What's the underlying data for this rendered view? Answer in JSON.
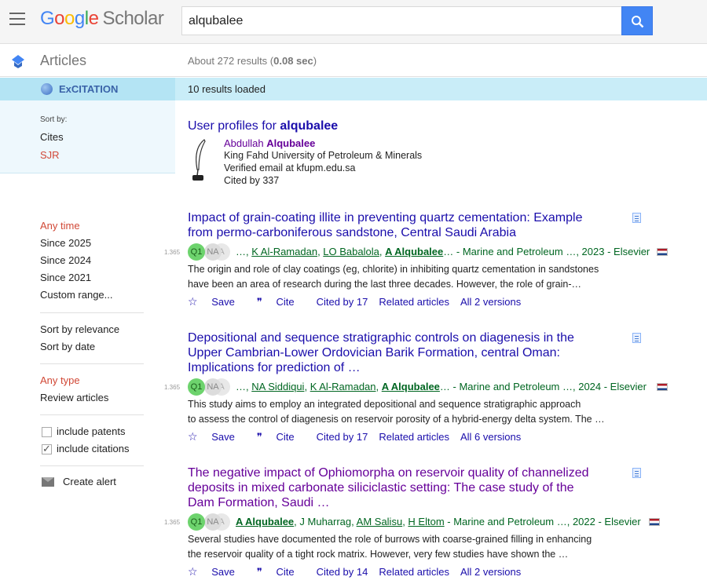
{
  "header": {
    "logo_letters": [
      "G",
      "o",
      "o",
      "g",
      "l",
      "e"
    ],
    "logo_suffix": "Scholar",
    "search_value": "alqubalee"
  },
  "subhead": {
    "section": "Articles",
    "results_prefix": "About 272 results (",
    "results_time": "0.08 sec",
    "results_suffix": ")"
  },
  "excitation": {
    "label": "ExCITATION",
    "status": "10 results loaded"
  },
  "sort_panel": {
    "label": "Sort by:",
    "cites": "Cites",
    "sjr": "SJR"
  },
  "time_filters": [
    "Any time",
    "Since 2025",
    "Since 2024",
    "Since 2021",
    "Custom range..."
  ],
  "sort_options": [
    "Sort by relevance",
    "Sort by date"
  ],
  "type_filters": [
    "Any type",
    "Review articles"
  ],
  "checks": {
    "patents": "include patents",
    "citations": "include citations"
  },
  "create_alert": "Create alert",
  "profiles": {
    "title_prefix": "User profiles for ",
    "title_query": "alqubalee",
    "name_first": "Abdullah ",
    "name_last": "Alqubalee",
    "affiliation": "King Fahd University of Petroleum & Minerals",
    "email": "Verified email at kfupm.edu.sa",
    "cited_by": "Cited by 337"
  },
  "results": [
    {
      "title_line1": "Impact of grain-coating illite in preventing quartz cementation: Example",
      "title_line2": "from permo-carboniferous sandstone, Central Saudi Arabia",
      "sjr": "1.365",
      "q1": "Q1",
      "na": "NA",
      "na2": "A",
      "authors_prefix": "…, ",
      "authors": [
        "K Al-Ramadan",
        "LO Babalola",
        "A Alqubalee"
      ],
      "authors_suffix": "… - Marine and Petroleum …, 2023 - Elsevier",
      "snippet_line1": "The origin and role of clay coatings (eg, chlorite) in inhibiting quartz cementation in sandstones",
      "snippet_line2": "have been an area of research during the last three decades. However, the role of grain-…",
      "save": "Save",
      "cite": "Cite",
      "cited_by": "Cited by 17",
      "related": "Related articles",
      "versions": "All 2 versions"
    },
    {
      "title_line1": "Depositional and sequence stratigraphic controls on diagenesis in the",
      "title_line2": "Upper Cambrian-Lower Ordovician Barik Formation, central Oman:",
      "title_line3": "Implications for prediction of …",
      "sjr": "1.365",
      "q1": "Q1",
      "na": "NA",
      "na2": "A",
      "authors_prefix": "…, ",
      "authors": [
        "NA Siddiqui",
        "K Al-Ramadan",
        "A Alqubalee"
      ],
      "authors_suffix": "… - Marine and Petroleum …, 2024 - Elsevier",
      "snippet_line1": "This study aims to employ an integrated depositional and sequence stratigraphic approach",
      "snippet_line2": "to assess the control of diagenesis on reservoir porosity of a hybrid-energy delta system. The …",
      "save": "Save",
      "cite": "Cite",
      "cited_by": "Cited by 17",
      "related": "Related articles",
      "versions": "All 6 versions"
    },
    {
      "title_line1": "The negative impact of Ophiomorpha on reservoir quality of channelized",
      "title_line2": "deposits in mixed carbonate siliciclastic setting: The case study of the",
      "title_line3": "Dam Formation, Saudi …",
      "sjr": "1.365",
      "q1": "Q1",
      "na": "NA",
      "na2": "A",
      "authors": [
        "A Alqubalee",
        "AM Salisu",
        "H Eltom"
      ],
      "authors_mid": ", J Muharrag, ",
      "authors_suffix": " - Marine and Petroleum …, 2022 - Elsevier",
      "snippet_line1": "Several studies have documented the role of burrows with coarse-grained filling in enhancing",
      "snippet_line2": "the reservoir quality of a tight rock matrix. However, very few studies have shown the …",
      "save": "Save",
      "cite": "Cite",
      "cited_by": "Cited by 14",
      "related": "Related articles",
      "versions": "All 2 versions"
    }
  ]
}
